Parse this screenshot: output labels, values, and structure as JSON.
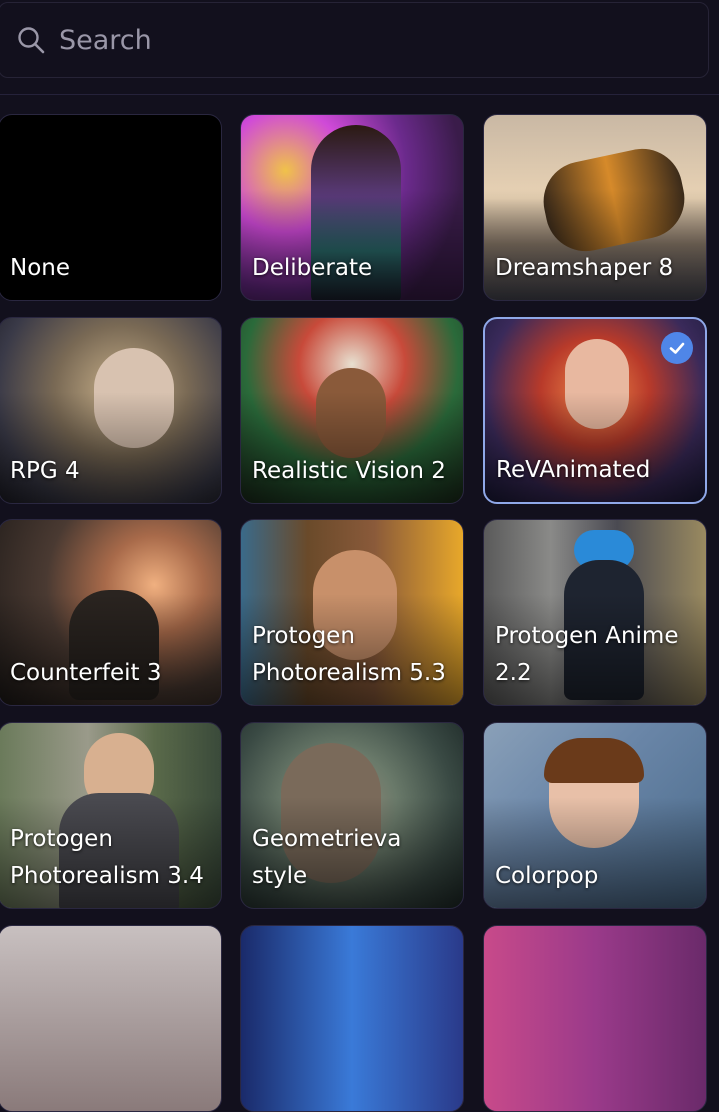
{
  "search": {
    "placeholder": "Search"
  },
  "models": [
    {
      "label": "None",
      "selected": false
    },
    {
      "label": "Deliberate",
      "selected": false
    },
    {
      "label": "Dreamshaper 8",
      "selected": false
    },
    {
      "label": "RPG 4",
      "selected": false
    },
    {
      "label": "Realistic Vision 2",
      "selected": false
    },
    {
      "label": "ReVAnimated",
      "selected": true
    },
    {
      "label": "Counterfeit 3",
      "selected": false
    },
    {
      "label": "Protogen Photorealism 5.3",
      "selected": false
    },
    {
      "label": "Protogen Anime 2.2",
      "selected": false
    },
    {
      "label": "Protogen Photorealism 3.4",
      "selected": false
    },
    {
      "label": "Geometrieva style",
      "selected": false
    },
    {
      "label": "Colorpop",
      "selected": false
    }
  ]
}
